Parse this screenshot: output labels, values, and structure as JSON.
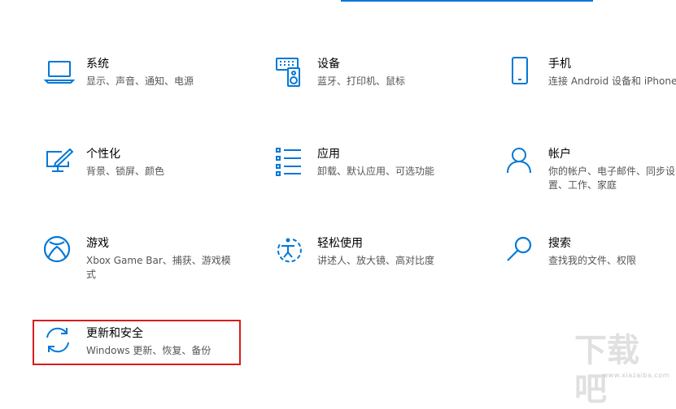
{
  "colors": {
    "accent": "#0078d7",
    "highlight": "#d71c1c"
  },
  "tiles": [
    {
      "name": "system",
      "icon": "laptop-icon",
      "title": "系统",
      "desc": "显示、声音、通知、电源"
    },
    {
      "name": "devices",
      "icon": "keyboard-speaker-icon",
      "title": "设备",
      "desc": "蓝牙、打印机、鼠标"
    },
    {
      "name": "phone",
      "icon": "phone-icon",
      "title": "手机",
      "desc": "连接 Android 设备和 iPhone"
    },
    {
      "name": "personalization",
      "icon": "pen-screen-icon",
      "title": "个性化",
      "desc": "背景、锁屏、颜色"
    },
    {
      "name": "apps",
      "icon": "apps-list-icon",
      "title": "应用",
      "desc": "卸载、默认应用、可选功能"
    },
    {
      "name": "accounts",
      "icon": "person-icon",
      "title": "帐户",
      "desc": "你的帐户、电子邮件、同步设置、工作、家庭"
    },
    {
      "name": "gaming",
      "icon": "xbox-icon",
      "title": "游戏",
      "desc": "Xbox Game Bar、捕获、游戏模式"
    },
    {
      "name": "ease-of-access",
      "icon": "ease-of-access-icon",
      "title": "轻松使用",
      "desc": "讲述人、放大镜、高对比度"
    },
    {
      "name": "search",
      "icon": "search-icon",
      "title": "搜索",
      "desc": "查找我的文件、权限"
    },
    {
      "name": "update-security",
      "icon": "sync-icon",
      "title": "更新和安全",
      "desc": "Windows 更新、恢复、备份"
    }
  ],
  "watermark": {
    "logo": "下载吧",
    "url": "www.xiazaiba.com"
  }
}
